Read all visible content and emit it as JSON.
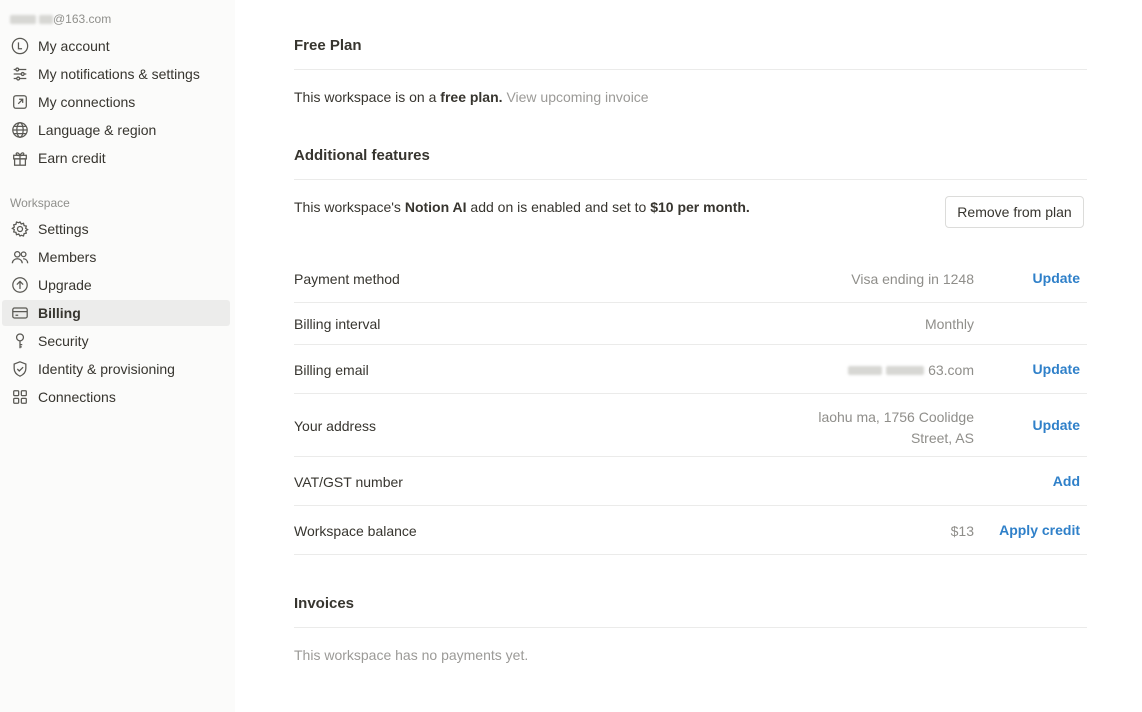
{
  "sidebar": {
    "account_email_suffix": "@163.com",
    "account_items": [
      {
        "label": "My account",
        "icon": "account-icon"
      },
      {
        "label": "My notifications & settings",
        "icon": "sliders-icon"
      },
      {
        "label": "My connections",
        "icon": "external-link-icon"
      },
      {
        "label": "Language & region",
        "icon": "globe-icon"
      },
      {
        "label": "Earn credit",
        "icon": "gift-icon"
      }
    ],
    "workspace_label": "Workspace",
    "workspace_items": [
      {
        "label": "Settings",
        "icon": "gear-icon"
      },
      {
        "label": "Members",
        "icon": "people-icon"
      },
      {
        "label": "Upgrade",
        "icon": "upgrade-icon"
      },
      {
        "label": "Billing",
        "icon": "card-icon",
        "active": true
      },
      {
        "label": "Security",
        "icon": "key-icon"
      },
      {
        "label": "Identity & provisioning",
        "icon": "shield-check-icon"
      },
      {
        "label": "Connections",
        "icon": "grid-icon"
      }
    ]
  },
  "plan": {
    "title": "Free Plan",
    "text_prefix": "This workspace is on a ",
    "text_bold": "free plan.",
    "invoice_link": "View upcoming invoice"
  },
  "features": {
    "title": "Additional features",
    "text_prefix": "This workspace's ",
    "text_bold1": "Notion AI",
    "text_mid": " add on is enabled and set to ",
    "text_bold2": "$10 per month.",
    "remove_button": "Remove from plan"
  },
  "billing_rows": [
    {
      "label": "Payment method",
      "value": "Visa ending in 1248",
      "action": "Update"
    },
    {
      "label": "Billing interval",
      "value": "Monthly",
      "action": ""
    },
    {
      "label": "Billing email",
      "value_suffix": "63.com",
      "action": "Update"
    },
    {
      "label": "Your address",
      "value_line1": "laohu ma, 1756 Coolidge",
      "value_line2": "Street, AS",
      "action": "Update"
    },
    {
      "label": "VAT/GST number",
      "value": "",
      "action": "Add"
    },
    {
      "label": "Workspace balance",
      "value": "$13",
      "action": "Apply credit"
    }
  ],
  "invoices": {
    "title": "Invoices",
    "empty_text": "This workspace has no payments yet."
  }
}
